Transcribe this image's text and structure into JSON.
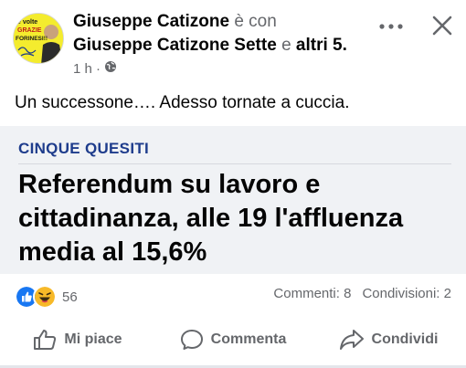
{
  "post": {
    "author": "Giuseppe Catizone",
    "with_text": "è con",
    "tagged": "Giuseppe Catizone Sette",
    "and_text": "e",
    "others": "altri 5",
    "period": ".",
    "time": "1 h ·",
    "privacy_icon": "globe-icon",
    "text": "Un successone…. Adesso tornate a cuccia."
  },
  "avatar": {
    "line1": "e volte",
    "line2": "GRAZIE",
    "line3": "FORINESI!!",
    "signature": "Giuseppe Catizone",
    "bg_color": "#f4ec2e"
  },
  "link_card": {
    "category": "CINQUE QUESITI",
    "title": "Referendum su lavoro e cittadinanza, alle 19 l'affluenza media al 15,6%",
    "category_color": "#1e3c8c",
    "bg_color": "#f0f2f5"
  },
  "engagement": {
    "reaction_count": "56",
    "comments": "Commenti: 8",
    "shares": "Condivisioni: 2",
    "reaction_icons": [
      "like-reaction-icon",
      "haha-reaction-icon"
    ]
  },
  "actions": {
    "like": "Mi piace",
    "comment": "Commenta",
    "share": "Condividi"
  },
  "colors": {
    "text": "#050505",
    "muted": "#65676b",
    "like_blue": "#1877f2",
    "haha_yellow": "#f7b928"
  }
}
